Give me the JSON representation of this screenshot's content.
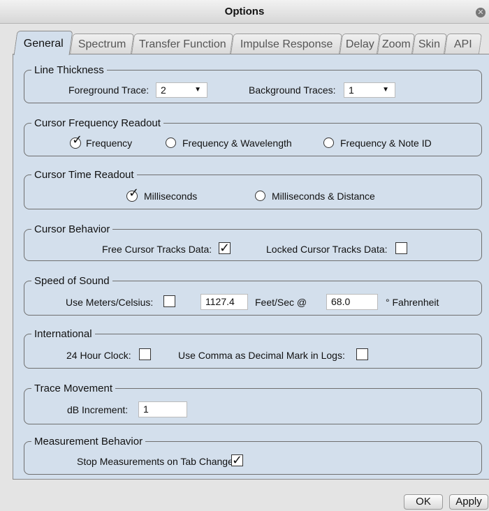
{
  "window": {
    "title": "Options"
  },
  "tabs": [
    "General",
    "Spectrum",
    "Transfer Function",
    "Impulse Response",
    "Delay",
    "Zoom",
    "Skin",
    "API"
  ],
  "line_thickness": {
    "legend": "Line Thickness",
    "fg_label": "Foreground Trace:",
    "fg_value": "2",
    "bg_label": "Background Traces:",
    "bg_value": "1"
  },
  "cursor_freq": {
    "legend": "Cursor Frequency Readout",
    "opt1": "Frequency",
    "opt2": "Frequency & Wavelength",
    "opt3": "Frequency & Note ID",
    "selected": "Frequency"
  },
  "cursor_time": {
    "legend": "Cursor Time Readout",
    "opt1": "Milliseconds",
    "opt2": "Milliseconds & Distance",
    "selected": "Milliseconds"
  },
  "cursor_behavior": {
    "legend": "Cursor Behavior",
    "free_label": "Free Cursor Tracks Data:",
    "free_checked": true,
    "locked_label": "Locked Cursor Tracks Data:",
    "locked_checked": false
  },
  "speed_of_sound": {
    "legend": "Speed of Sound",
    "meters_label": "Use Meters/Celsius:",
    "meters_checked": false,
    "speed_value": "1127.4",
    "speed_unit": "Feet/Sec @",
    "temp_value": "68.0",
    "temp_unit": "° Fahrenheit"
  },
  "international": {
    "legend": "International",
    "clock_label": "24 Hour Clock:",
    "clock_checked": false,
    "comma_label": "Use Comma as Decimal Mark in Logs:",
    "comma_checked": false
  },
  "trace_movement": {
    "legend": "Trace Movement",
    "db_label": "dB Increment:",
    "db_value": "1"
  },
  "measurement": {
    "legend": "Measurement Behavior",
    "stop_label": "Stop Measurements on Tab Change:",
    "stop_checked": true
  },
  "buttons": {
    "ok": "OK",
    "apply": "Apply"
  },
  "glyphs": {
    "check": "✓",
    "close": "✕",
    "dropdown_arrow": "▼"
  }
}
